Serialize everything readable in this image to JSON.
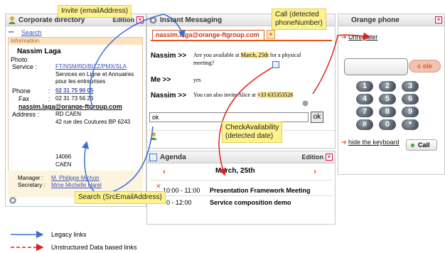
{
  "callouts": {
    "invite": "Invite (emailAddress)",
    "call": "Call (detected\nphoneNumber)",
    "check": "CheckAvailability\n(detected date)",
    "search": "Search (SrcEmailAddress)"
  },
  "directory": {
    "title": "Corporate directory",
    "edition": "Edition",
    "search_link": "Search",
    "info_label": "Information",
    "name": "Nassim Laga",
    "photo_label": "Photo",
    "service_label": "Service :",
    "service_code": "FT/NSM/RD/BIZZ/PMX/SLA",
    "service_desc": "Services en Ligne et Annuaires pour les entreprises",
    "phone_label": "Phone",
    "phone_value": "02 31 75 90 05",
    "fax_label": "Fax",
    "fax_value": "02 31 73 56 26",
    "email": "nassim.laga@orange-ftgroup.com",
    "address_label": "Address :",
    "address_line1": "RD CAEN",
    "address_line2": "42 rue des Coutures BP 6243",
    "postcode": "14066",
    "city": "CAEN",
    "manager_label": "Manager :",
    "manager_value": "M. Philippe Michon",
    "secretary_label": "Secretary :",
    "secretary_value": "Mme Michelle Harel"
  },
  "im": {
    "title": "Instant Messaging",
    "tab": "nassim.laga@orange-ftgroup.com",
    "tab_add": "+",
    "msg1_speaker": "Nassim  >>",
    "msg1_before": "Are you available at ",
    "msg1_date": "March, 25th",
    "msg1_after": " for a physical",
    "msg1_line2": "meeting?",
    "msg2_speaker": "Me  >>",
    "msg2_text": "yes",
    "msg3_speaker": "Nassim  >>",
    "msg3_before": "You can also invite Alice at ",
    "msg3_phone": "+33 635353526",
    "input_value": "ok",
    "ok_button": "ok"
  },
  "agenda": {
    "title": "Agenda",
    "edition": "Edition",
    "prev": "‹",
    "date": "March, 25th",
    "next": "›",
    "events": [
      {
        "time": "10:00 - 11:00",
        "label": "Presentation Framework Meeting"
      },
      {
        "time": "  0 - 12:00",
        "label": "Service composition demo"
      }
    ]
  },
  "phone": {
    "title": "Orange phone",
    "unregister": "Unregister",
    "logo": "c ole",
    "keys": [
      "1",
      "2",
      "3",
      "4",
      "5",
      "6",
      "7",
      "8",
      "9",
      "#",
      "0",
      "*"
    ],
    "hide_keyboard": "hide the keyboard",
    "call_button": "Call"
  },
  "legend": {
    "legacy": "Legacy links",
    "unstructured": "Unstructured Data based links"
  },
  "colors": {
    "legacy": "#3a6fd8",
    "unstructured": "#e02020",
    "callout": "#fdf28d",
    "orange": "#e2541a"
  }
}
